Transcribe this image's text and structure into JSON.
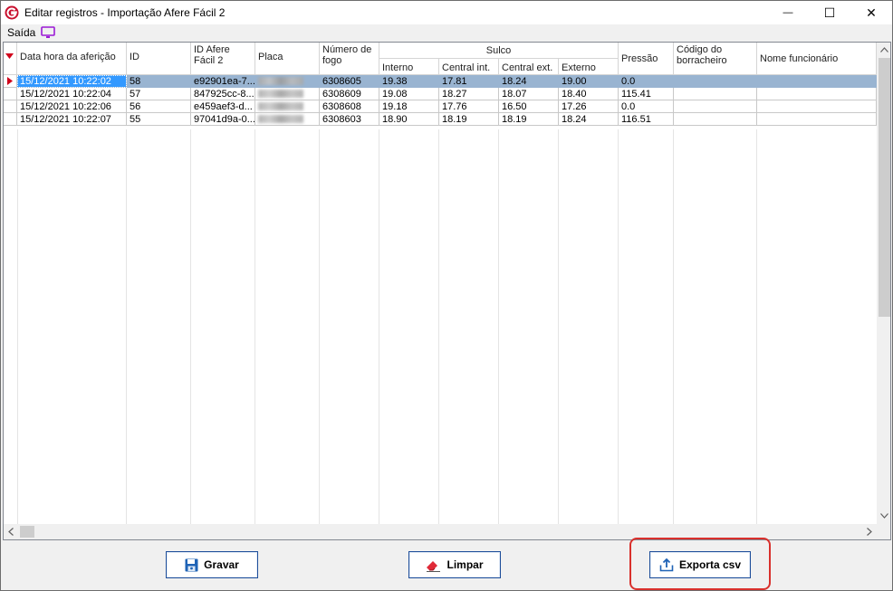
{
  "window": {
    "title": "Editar registros - Importação Afere Fácil 2",
    "minimize_glyph": "—",
    "maximize_glyph": "☐",
    "close_glyph": "✕"
  },
  "menu": {
    "saida_label": "Saída"
  },
  "grid": {
    "headers": {
      "data_hora": "Data hora da aferição",
      "id": "ID",
      "id_afere": "ID Afere Fácil 2",
      "placa": "Placa",
      "numero_fogo": "Número de fogo",
      "sulco": "Sulco",
      "interno": "Interno",
      "central_int": "Central int.",
      "central_ext": "Central ext.",
      "externo": "Externo",
      "pressao": "Pressão",
      "codigo_borracheiro": "Código do borracheiro",
      "nome_funcionario": "Nome funcionário"
    },
    "rows": [
      {
        "data_hora": "15/12/2021 10:22:02",
        "id": "58",
        "id_afere": "e92901ea-7...",
        "numero_fogo": "6308605",
        "interno": "19.38",
        "central_int": "17.81",
        "central_ext": "18.24",
        "externo": "19.00",
        "pressao": "0.0",
        "codigo": "",
        "nome": ""
      },
      {
        "data_hora": "15/12/2021 10:22:04",
        "id": "57",
        "id_afere": "847925cc-8...",
        "numero_fogo": "6308609",
        "interno": "19.08",
        "central_int": "18.27",
        "central_ext": "18.07",
        "externo": "18.40",
        "pressao": "115.41",
        "codigo": "",
        "nome": ""
      },
      {
        "data_hora": "15/12/2021 10:22:06",
        "id": "56",
        "id_afere": "e459aef3-d...",
        "numero_fogo": "6308608",
        "interno": "19.18",
        "central_int": "17.76",
        "central_ext": "16.50",
        "externo": "17.26",
        "pressao": "0.0",
        "codigo": "",
        "nome": ""
      },
      {
        "data_hora": "15/12/2021 10:22:07",
        "id": "55",
        "id_afere": "97041d9a-0...",
        "numero_fogo": "6308603",
        "interno": "18.90",
        "central_int": "18.19",
        "central_ext": "18.19",
        "externo": "18.24",
        "pressao": "116.51",
        "codigo": "",
        "nome": ""
      }
    ],
    "selected_row": 0
  },
  "buttons": {
    "gravar": "Gravar",
    "limpar": "Limpar",
    "exporta_csv": "Exporta csv"
  },
  "colors": {
    "selection": "#99b4d1",
    "selection_focus": "#3399ff",
    "highlight_border": "#d9302c",
    "button_border": "#1e4e9a",
    "sort_indicator": "#d0021b"
  },
  "icons": {
    "app": "app-logo-icon",
    "saida": "monitor-icon",
    "gravar": "floppy-disk-icon",
    "limpar": "eraser-icon",
    "exporta": "export-upload-icon"
  }
}
